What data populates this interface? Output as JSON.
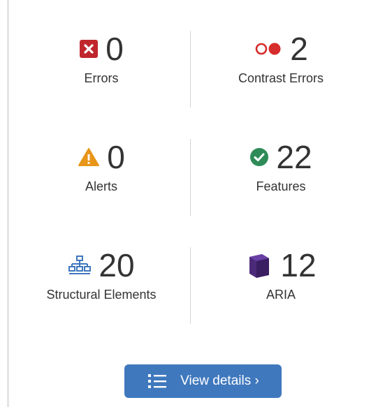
{
  "summary": {
    "errors": {
      "icon": "error-x-icon",
      "count": "0",
      "label": "Errors",
      "color": "#c0272d"
    },
    "contrast_errors": {
      "icon": "contrast-icon",
      "count": "2",
      "label": "Contrast Errors",
      "color": "#d62c2c"
    },
    "alerts": {
      "icon": "alert-triangle-icon",
      "count": "0",
      "label": "Alerts",
      "color": "#e8961a"
    },
    "features": {
      "icon": "check-circle-icon",
      "count": "22",
      "label": "Features",
      "color": "#2e8b57"
    },
    "structural": {
      "icon": "hierarchy-icon",
      "count": "20",
      "label": "Structural Elements",
      "color": "#3f78bd"
    },
    "aria": {
      "icon": "aria-cube-icon",
      "count": "12",
      "label": "ARIA",
      "color": "#4b2a7a"
    }
  },
  "details_button": {
    "label": "View details ›",
    "icon": "list-icon",
    "color": "#3f78bd"
  }
}
